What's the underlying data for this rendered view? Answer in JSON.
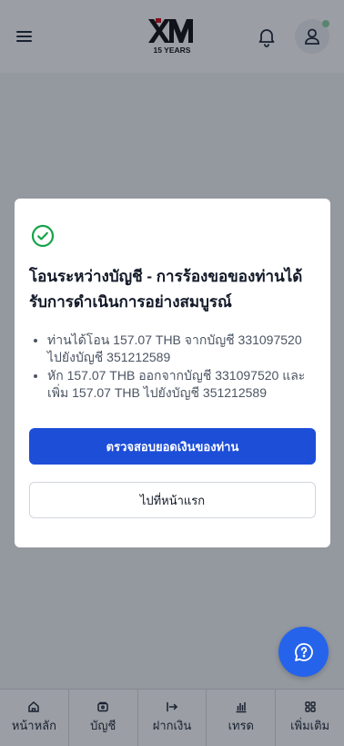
{
  "header": {
    "logo_text": "XM",
    "logo_subtext": "15 YEARS"
  },
  "modal": {
    "title": "โอนระหว่างบัญชี - การร้องขอของท่านได้รับการดำเนินการอย่างสมบูรณ์",
    "details": [
      "ท่านได้โอน 157.07 THB จากบัญชี 331097520 ไปยังบัญชี 351212589",
      "หัก 157.07 THB ออกจากบัญชี 331097520 และเพิ่ม 157.07 THB ไปยังบัญชี 351212589"
    ],
    "primary_button": "ตรวจสอบยอดเงินของท่าน",
    "secondary_button": "ไปที่หน้าแรก"
  },
  "tabs": [
    {
      "label": "หน้าหลัก",
      "icon": "home-icon"
    },
    {
      "label": "บัญชี",
      "icon": "wallet-icon"
    },
    {
      "label": "ฝากเงิน",
      "icon": "deposit-arrow-icon"
    },
    {
      "label": "เทรด",
      "icon": "chart-icon"
    },
    {
      "label": "เพิ่มเติม",
      "icon": "grid-icon"
    }
  ],
  "colors": {
    "primary": "#1d4ed8",
    "success": "#16a34a",
    "logo_red": "#d0101f"
  }
}
